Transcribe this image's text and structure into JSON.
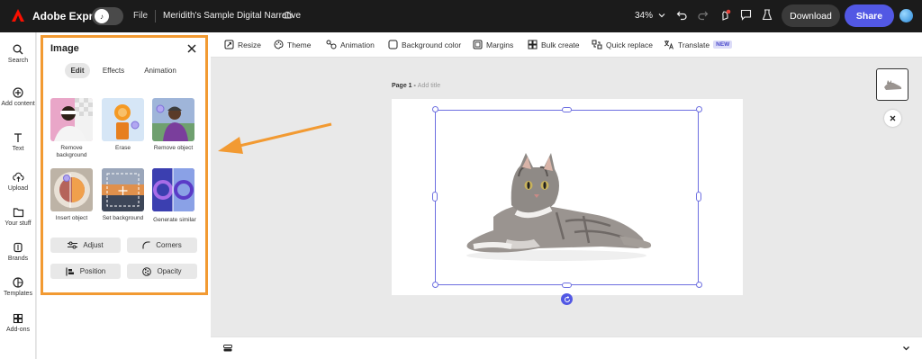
{
  "topbar": {
    "brand": "Adobe Express",
    "file_label": "File",
    "doc_title": "Meridith's Sample Digital Narrative",
    "zoom": "34%",
    "download_label": "Download",
    "share_label": "Share"
  },
  "rail": {
    "items": [
      {
        "label": "Search",
        "icon": "search-icon"
      },
      {
        "label": "Add content",
        "icon": "plus-circle-icon"
      },
      {
        "label": "Text",
        "icon": "text-icon"
      },
      {
        "label": "Upload",
        "icon": "upload-icon"
      },
      {
        "label": "Your stuff",
        "icon": "folder-icon"
      },
      {
        "label": "Brands",
        "icon": "brand-icon"
      },
      {
        "label": "Templates",
        "icon": "templates-icon"
      },
      {
        "label": "Add-ons",
        "icon": "addons-icon"
      }
    ]
  },
  "panel": {
    "title": "Image",
    "tabs": [
      "Edit",
      "Effects",
      "Animation"
    ],
    "tiles": [
      {
        "label": "Remove background"
      },
      {
        "label": "Erase"
      },
      {
        "label": "Remove object"
      },
      {
        "label": "Insert object"
      },
      {
        "label": "Set background"
      },
      {
        "label": "Generate similar"
      }
    ],
    "buttons": [
      "Adjust",
      "Corners",
      "Position",
      "Opacity"
    ]
  },
  "toolbar": {
    "items": [
      "Resize",
      "Theme",
      "Animation",
      "Background color",
      "Margins",
      "Bulk create",
      "Quick replace",
      "Translate"
    ],
    "new_badge": "NEW"
  },
  "canvas": {
    "page_label": "Page 1 - ",
    "add_title": "Add title"
  },
  "colors": {
    "accent": "#5258e4",
    "highlight": "#f29a32",
    "topbar": "#1b1b1b"
  }
}
